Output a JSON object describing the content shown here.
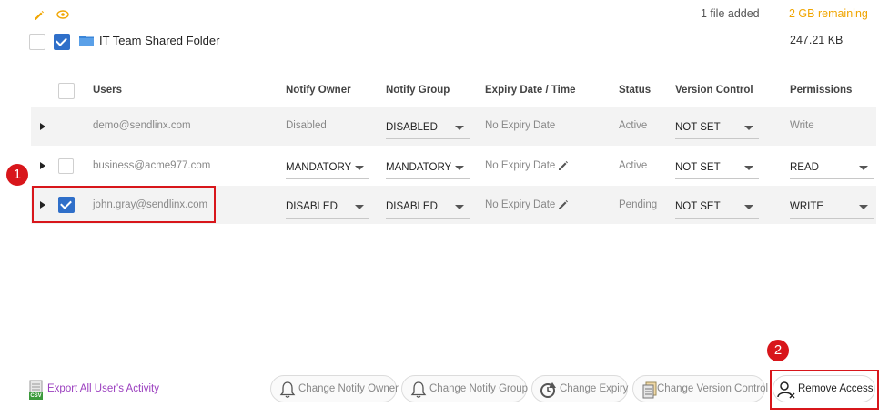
{
  "top": {
    "files_added": "1 file added",
    "remaining": "2 GB remaining",
    "size": "247.21 KB",
    "folder_name": "IT Team Shared Folder"
  },
  "table": {
    "headers": [
      "Users",
      "Notify Owner",
      "Notify Group",
      "Expiry Date / Time",
      "Status",
      "Version Control",
      "Permissions"
    ],
    "rows": [
      {
        "user": "demo@sendlinx.com",
        "notify_owner": "Disabled",
        "notify_group": "DISABLED",
        "expiry": "No Expiry Date",
        "status": "Active",
        "version": "NOT SET",
        "permissions": "Write",
        "checked": false
      },
      {
        "user": "business@acme977.com",
        "notify_owner": "MANDATORY",
        "notify_group": "MANDATORY",
        "expiry": "No Expiry Date",
        "status": "Active",
        "version": "NOT SET",
        "permissions": "READ",
        "checked": false
      },
      {
        "user": "john.gray@sendlinx.com",
        "notify_owner": "DISABLED",
        "notify_group": "DISABLED",
        "expiry": "No Expiry Date",
        "status": "Pending",
        "version": "NOT SET",
        "permissions": "WRITE",
        "checked": true
      }
    ]
  },
  "annotations": {
    "badge1": "1",
    "badge2": "2"
  },
  "toolbar": {
    "export": "Export All User's Activity",
    "export_icon_text": "CSV",
    "notify_owner": "Change Notify Owner",
    "notify_group": "Change Notify Group",
    "expiry": "Change Expiry",
    "version": "Change Version Control",
    "remove": "Remove Access"
  },
  "colors": {
    "accent": "#f0a500",
    "check": "#2f6fc9",
    "annotation": "#d8161b",
    "export_link": "#9b3fbf"
  }
}
